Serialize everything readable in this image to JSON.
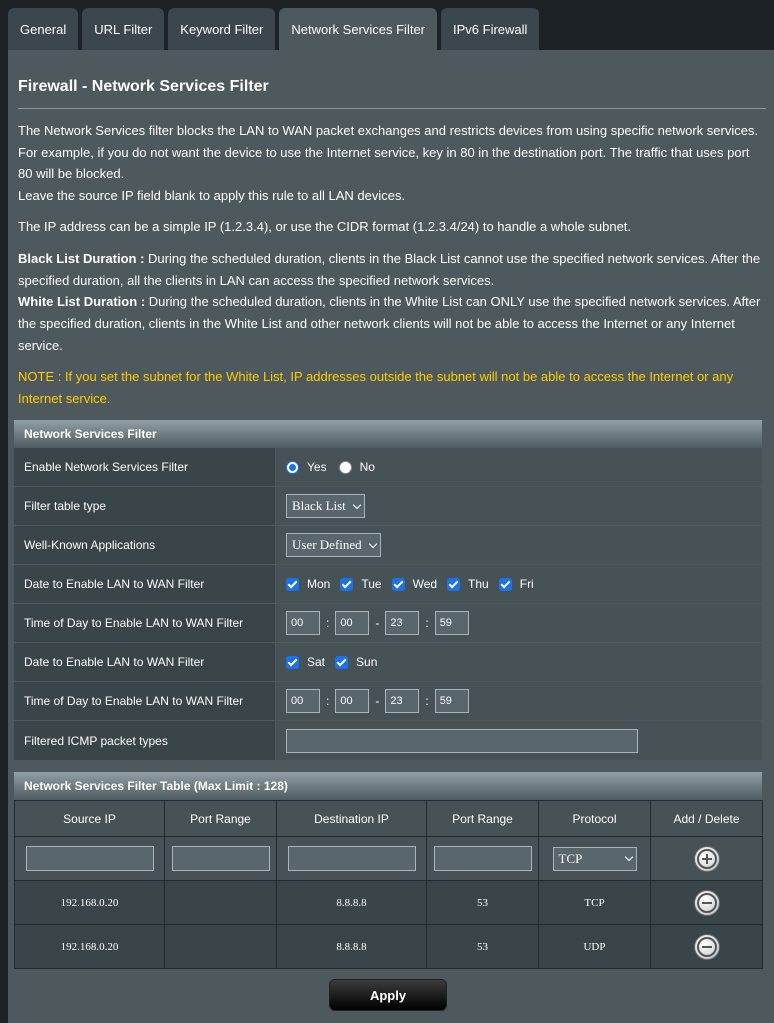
{
  "tabs": [
    {
      "label": "General"
    },
    {
      "label": "URL Filter"
    },
    {
      "label": "Keyword Filter"
    },
    {
      "label": "Network Services Filter"
    },
    {
      "label": "IPv6 Firewall"
    }
  ],
  "active_tab": "Network Services Filter",
  "page_title": "Firewall - Network Services Filter",
  "description": {
    "p1_line1": "The Network Services filter blocks the LAN to WAN packet exchanges and restricts devices from using specific network services.",
    "p1_line2": "For example, if you do not want the device to use the Internet service, key in 80 in the destination port. The traffic that uses port",
    "p1_line3": "80 will be blocked.",
    "p1_line4": "Leave the source IP field blank to apply this rule to all LAN devices.",
    "p2": "The IP address can be a simple IP (1.2.3.4), or use the CIDR format (1.2.3.4/24) to handle a whole subnet.",
    "black_label": "Black List Duration :",
    "black_line1": " During the scheduled duration, clients in the Black List cannot use the specified network services. After the",
    "black_line2": "specified duration, all the clients in LAN can access the specified network services.",
    "white_label": "White List Duration :",
    "white_line1": " During the scheduled duration, clients in the White List can ONLY use the specified network services. After",
    "white_line2": "the specified duration, clients in the White List and other network clients will not be able to access the Internet or any Internet",
    "white_line3": "service.",
    "note_line1": "NOTE : If you set the subnet for the White List, IP addresses outside the subnet will not be able to access the Internet or any",
    "note_line2": "Internet service."
  },
  "filter_section": {
    "header": "Network Services Filter",
    "enable_label": "Enable Network Services Filter",
    "yes_label": "Yes",
    "no_label": "No",
    "enabled": true,
    "table_type_label": "Filter table type",
    "table_type_value": "Black List",
    "apps_label": "Well-Known Applications",
    "apps_value": "User Defined",
    "weekday_label": "Date to Enable LAN to WAN Filter",
    "weekdays": [
      "Mon",
      "Tue",
      "Wed",
      "Thu",
      "Fri"
    ],
    "weekday_time_label": "Time of Day to Enable LAN to WAN Filter",
    "weekday_time": {
      "start_h": "00",
      "start_m": "00",
      "end_h": "23",
      "end_m": "59"
    },
    "weekend_label": "Date to Enable LAN to WAN Filter",
    "weekend_days": [
      "Sat",
      "Sun"
    ],
    "weekend_time_label": "Time of Day to Enable LAN to WAN Filter",
    "weekend_time": {
      "start_h": "00",
      "start_m": "00",
      "end_h": "23",
      "end_m": "59"
    },
    "icmp_label": "Filtered ICMP packet types",
    "icmp_value": ""
  },
  "rules_table": {
    "header": "Network Services Filter Table (Max Limit : 128)",
    "columns": [
      "Source IP",
      "Port Range",
      "Destination IP",
      "Port Range",
      "Protocol",
      "Add / Delete"
    ],
    "new_protocol": "TCP",
    "rows": [
      {
        "source_ip": "192.168.0.20",
        "src_port": "",
        "dest_ip": "8.8.8.8",
        "dest_port": "53",
        "protocol": "TCP"
      },
      {
        "source_ip": "192.168.0.20",
        "src_port": "",
        "dest_ip": "8.8.8.8",
        "dest_port": "53",
        "protocol": "UDP"
      }
    ]
  },
  "apply_label": "Apply"
}
